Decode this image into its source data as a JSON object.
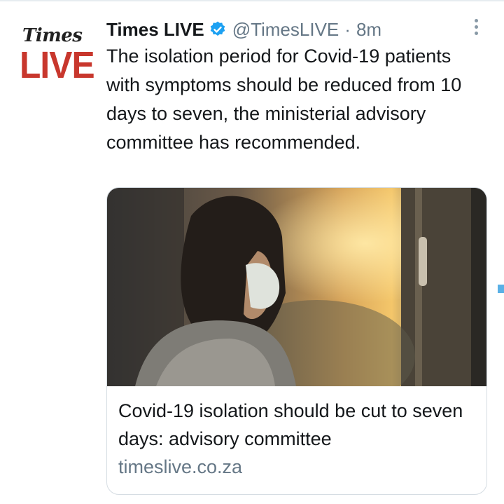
{
  "author": {
    "avatar_text_top": "Times",
    "avatar_text_bottom": "LIVE",
    "name": "Times LIVE",
    "handle": "@TimesLIVE",
    "separator": "·",
    "time": "8m"
  },
  "tweet": {
    "text": "The isolation period for Covid-19 patients with symptoms should be reduced from 10 days to seven, the ministerial advisory committee has recommended."
  },
  "card": {
    "title": "Covid-19 isolation should be cut to seven days: advisory committee",
    "domain": "timeslive.co.za"
  },
  "icons": {
    "verified": "verified-badge-icon",
    "more": "more-options-icon"
  },
  "colors": {
    "brand_red": "#c8372d",
    "verified_blue": "#1da1f2",
    "muted": "#657786"
  }
}
